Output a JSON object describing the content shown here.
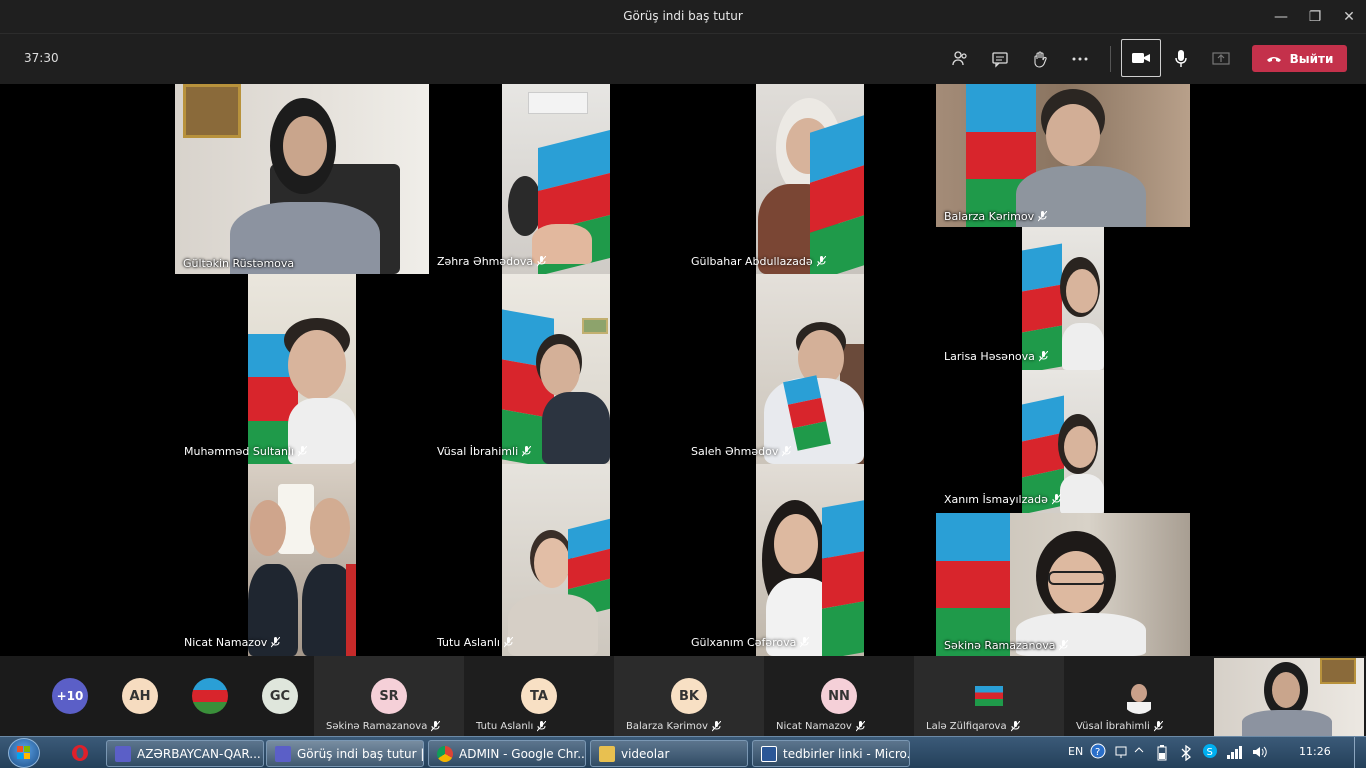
{
  "window": {
    "title": "Görüş indi baş tutur",
    "minimize": "—",
    "maximize": "❐",
    "close": "✕"
  },
  "toolbar": {
    "timer": "37:30",
    "leave_label": "Выйти"
  },
  "tiles": [
    {
      "name": "Gültəkin Rüstəmova"
    },
    {
      "name": "Zəhra Əhmədova"
    },
    {
      "name": "Gülbahar Abdullazadə"
    },
    {
      "name": "Balarza Kərimov"
    },
    {
      "name": "Muhəmməd Sultanlı"
    },
    {
      "name": "Vüsal İbrahimli"
    },
    {
      "name": "Saleh Əhmədov"
    },
    {
      "name": "Larisa Həsənova"
    },
    {
      "name": "Xanım İsmayılzadə"
    },
    {
      "name": "Nicat Namazov"
    },
    {
      "name": "Tutu Aslanlı"
    },
    {
      "name": "Gülxanım Cəfərova"
    },
    {
      "name": "Səkinə Ramazanova"
    }
  ],
  "roster": {
    "overflow": "+10",
    "avatars": [
      {
        "initials": "AH",
        "color": "#f6dcc0"
      },
      {
        "initials": "",
        "color": "#3a8f3a"
      },
      {
        "initials": "GC",
        "color": "#dfe6dc"
      }
    ],
    "participants": [
      {
        "initials": "SR",
        "name": "Səkinə Ramazanova",
        "color": "#f5d0d8"
      },
      {
        "initials": "TA",
        "name": "Tutu Aslanlı",
        "color": "#f8e0c4"
      },
      {
        "initials": "BK",
        "name": "Balarza Kərimov",
        "color": "#f8e0c4"
      },
      {
        "initials": "NN",
        "name": "Nicat Namazov",
        "color": "#f5d0d8"
      },
      {
        "initials": "",
        "name": "Lalə Zülfiqarova",
        "color": "#ffffff"
      },
      {
        "initials": "",
        "name": "Vüsal İbrahimli",
        "color": "#d8d8d8"
      }
    ]
  },
  "taskbar": {
    "tasks": [
      {
        "label": "AZƏRBAYCAN-QAR...",
        "color": "#5b5fc7"
      },
      {
        "label": "Görüş indi baş tutur |...",
        "color": "#5b5fc7"
      },
      {
        "label": "ADMIN - Google Chr...",
        "color": "#e0b020"
      },
      {
        "label": "videolar",
        "color": "#e8c050"
      },
      {
        "label": "tedbirler linki - Micro...",
        "color": "#2b5797"
      }
    ],
    "language": "EN",
    "time": "11:26"
  }
}
